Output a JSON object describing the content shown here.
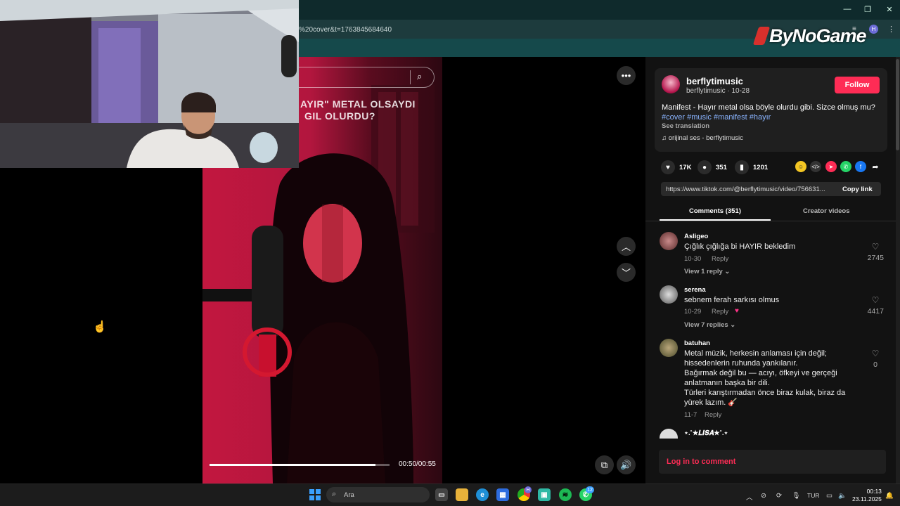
{
  "browser": {
    "url": "%20cover&t=1763845684640",
    "window_controls": {
      "minimize": "—",
      "restore": "❐",
      "close": "✕"
    },
    "profile_initial": "H"
  },
  "logo": {
    "text": "ByNoGame"
  },
  "video": {
    "overlay_line1": "AYIR\" METAL OLSAYDI",
    "overlay_line2": "GIL OLURDU?",
    "time": "00:50/00:55",
    "progress": 0.92
  },
  "post": {
    "author": "berflytimusic",
    "author_sub": "berflytimusic · 10-28",
    "follow_label": "Follow",
    "caption": "Manifest - Hayır metal olsa böyle olurdu gibi. Sizce olmuş mu?",
    "hashtags": [
      "#cover",
      "#music",
      "#manifest",
      "#hayır"
    ],
    "see_translation": "See translation",
    "sound": "orijinal ses - berflytimusic"
  },
  "stats": {
    "likes": "17K",
    "comments": "351",
    "saves": "1201"
  },
  "link": {
    "url": "https://www.tiktok.com/@berflytimusic/video/756631...",
    "copy_label": "Copy link"
  },
  "tabs": {
    "comments": "Comments (351)",
    "creator": "Creator videos"
  },
  "comments": [
    {
      "user": "Asligeo",
      "text": [
        "Çığlık çığlığa bi HAYIR bekledim"
      ],
      "date": "10-30",
      "reply": "Reply",
      "view_replies": "View 1 reply ⌄",
      "likes": "2745"
    },
    {
      "user": "serena",
      "text": [
        "sebnem ferah sarkısı olmus"
      ],
      "date": "10-29",
      "reply": "Reply",
      "view_replies": "View 7 replies ⌄",
      "likes": "4417"
    },
    {
      "user": "batuhan",
      "text": [
        "Metal müzik, herkesin anlaması için değil;",
        "hissedenlerin ruhunda yankılanır.",
        "Bağırmak değil bu — acıyı, öfkeyi ve gerçeği",
        "anlatmanın başka bir dili.",
        "Türleri karıştırmadan önce biraz kulak, biraz da",
        "yürek lazım. 🎸"
      ],
      "date": "11-7",
      "reply": "Reply",
      "view_replies": "",
      "likes": "0"
    },
    {
      "user": "⋆.˚★𝑳𝑰𝑺𝑨★˚.⋆"
    }
  ],
  "login": {
    "label": "Log in to comment"
  },
  "taskbar": {
    "search_placeholder": "Ara",
    "language": "TUR",
    "time": "00:13",
    "date": "23.11.2025",
    "whatsapp_badge": "12",
    "chrome_badge": "H"
  }
}
